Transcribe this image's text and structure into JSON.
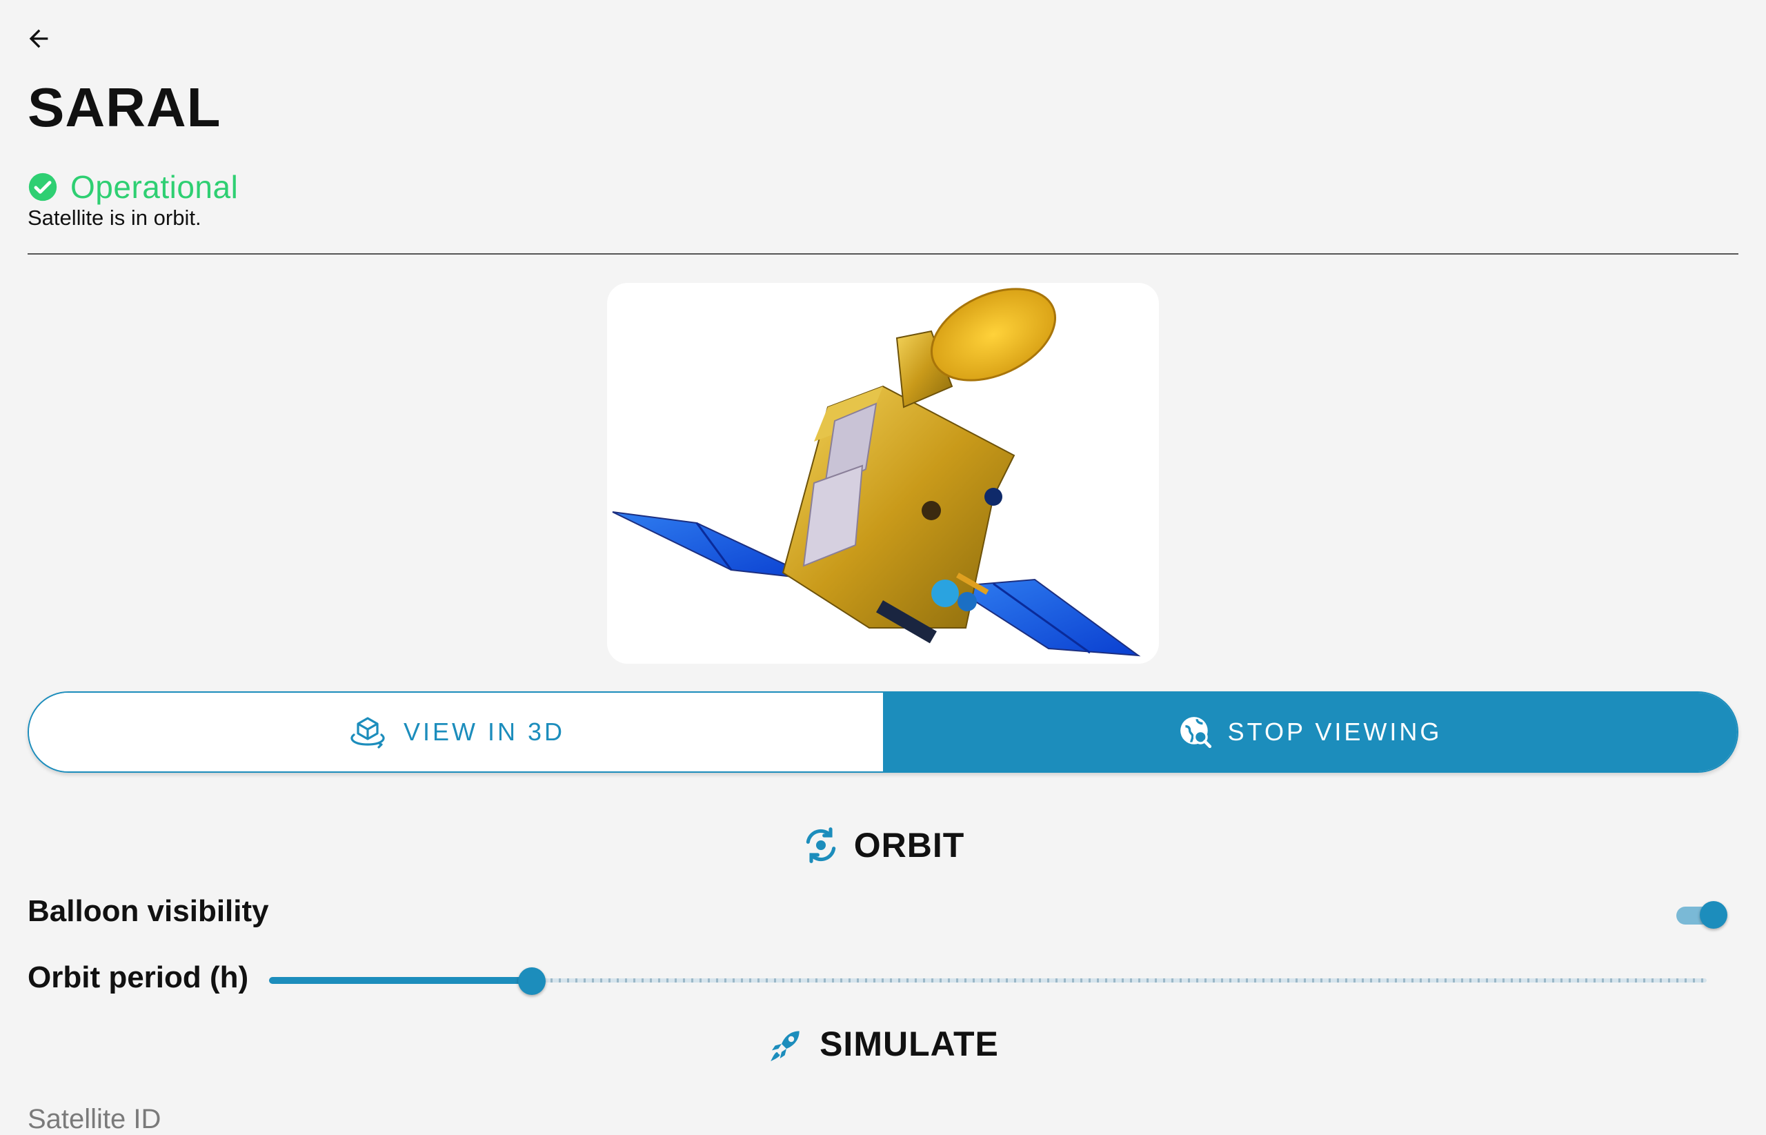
{
  "header": {
    "back_icon": "arrow-left-icon",
    "title": "SARAL"
  },
  "status": {
    "icon": "check-circle-icon",
    "label": "Operational",
    "description": "Satellite is in orbit.",
    "color": "#2ecf72"
  },
  "image": {
    "alt": "SARAL satellite"
  },
  "view_toggle": {
    "view3d_label": "VIEW IN 3D",
    "view3d_icon": "cube-rotate-icon",
    "stop_label": "STOP VIEWING",
    "stop_icon": "globe-search-icon",
    "selected": "STOP VIEWING"
  },
  "orbit": {
    "heading": "ORBIT",
    "icon": "orbit-refresh-icon",
    "balloon_label": "Balloon visibility",
    "balloon_on": true,
    "period_label": "Orbit period (h)",
    "period_fraction": 0.183
  },
  "simulate": {
    "heading": "SIMULATE",
    "icon": "rocket-icon"
  },
  "field": {
    "satellite_id_label": "Satellite ID"
  },
  "colors": {
    "accent": "#1c8dbc",
    "background": "#f4f4f4"
  }
}
